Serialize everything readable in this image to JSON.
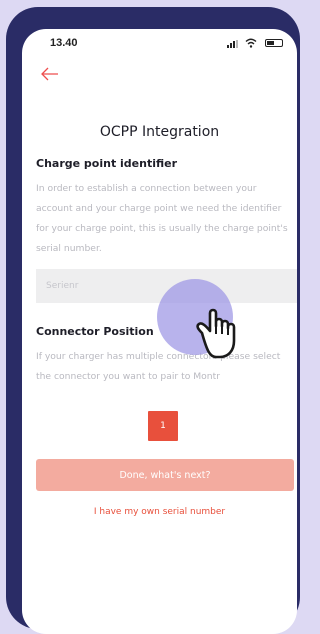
{
  "status_bar": {
    "time": "13.40"
  },
  "header": {
    "title": "OCPP Integration"
  },
  "charge_point": {
    "label": "Charge point identifier",
    "description": "In order to establish a connection between your account and your charge point we need the identifier for your charge point, this is usually the charge point's serial number.",
    "input_placeholder": "Serienr",
    "input_value": ""
  },
  "connector": {
    "label": "Connector Position",
    "description": "If your charger has multiple connectors please select the connector you want to pair to Montr",
    "selected_position": "1"
  },
  "actions": {
    "primary_label": "Done, what's next?",
    "link_label": "I have my own serial number"
  },
  "colors": {
    "accent": "#e8503c",
    "primary_disabled": "#f3ab9f",
    "phone_frame": "#2a2c66",
    "background": "#ddd9f3",
    "touch_highlight": "#9c96e4"
  },
  "icons": {
    "back": "back-arrow-icon",
    "touch": "hand-pointer-icon"
  }
}
